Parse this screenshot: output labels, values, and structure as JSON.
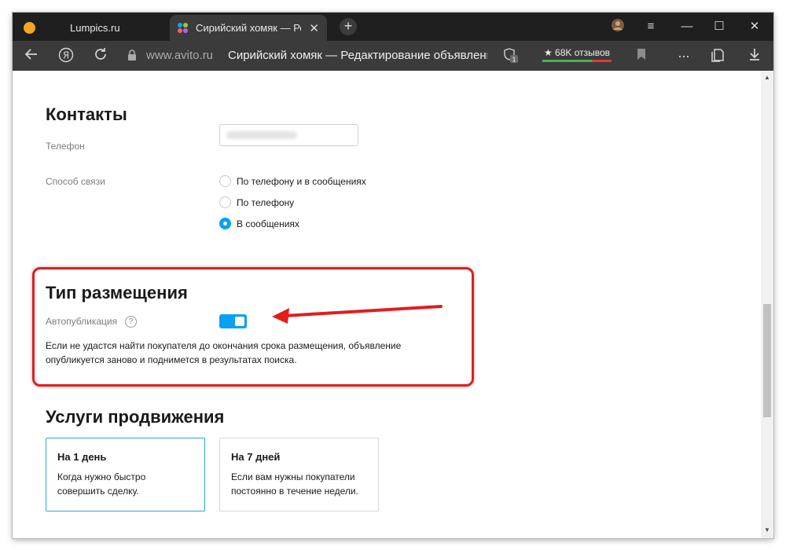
{
  "browser": {
    "tabs": [
      {
        "title": "Lumpics.ru"
      },
      {
        "title": "Сирийский хомяк — Редактирование объявления",
        "close": "✕"
      }
    ],
    "new_tab": "+",
    "window_controls": {
      "menu": "≡",
      "minimize": "—",
      "maximize": "☐",
      "close": "✕"
    },
    "address": {
      "domain": "www.avito.ru",
      "title": "Сирийский хомяк — Редактирование объявления"
    },
    "reviews": "★ 68K отзывов",
    "protect_badge": "1",
    "more": "...",
    "icons": [
      "back-icon",
      "yandex-icon",
      "reload-icon",
      "lock-icon",
      "protect-icon",
      "bookmark-icon",
      "downloads-icon"
    ]
  },
  "contacts": {
    "heading": "Контакты",
    "phone_label": "Телефон",
    "phone_value": "",
    "method_label": "Способ связи",
    "options": [
      {
        "label": "По телефону и в сообщениях",
        "checked": false
      },
      {
        "label": "По телефону",
        "checked": false
      },
      {
        "label": "В сообщениях",
        "checked": true
      }
    ]
  },
  "placement": {
    "heading": "Тип размещения",
    "autopub_label": "Автопубликация",
    "help": "?",
    "autopub_enabled": true,
    "description": "Если не удастся найти покупателя до окончания срока размещения, объявление опубликуется заново и поднимется в результатах поиска."
  },
  "promotion": {
    "heading": "Услуги продвижения",
    "cards": [
      {
        "title": "На 1 день",
        "desc": "Когда нужно быстро совершить сделку.",
        "selected": true
      },
      {
        "title": "На 7 дней",
        "desc": "Если вам нужны покупатели постоянно в течение недели.",
        "selected": false
      }
    ]
  },
  "colors": {
    "accent_blue": "#0aa0f5",
    "annotation_red": "#e21d1d",
    "selected_card_border": "#29a9c7"
  }
}
